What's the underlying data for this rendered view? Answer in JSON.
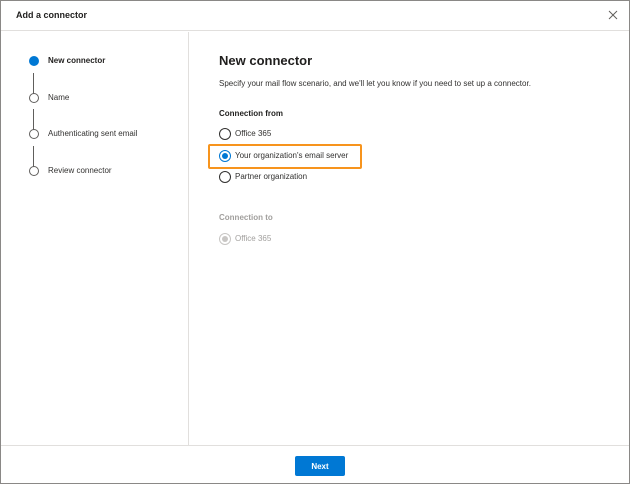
{
  "dialog": {
    "title": "Add a connector",
    "close_icon": "close-icon"
  },
  "steps": [
    {
      "label": "New connector",
      "active": true
    },
    {
      "label": "Name",
      "active": false
    },
    {
      "label": "Authenticating sent email",
      "active": false
    },
    {
      "label": "Review connector",
      "active": false
    }
  ],
  "main": {
    "title": "New connector",
    "description": "Specify your mail flow scenario, and we'll let you know if you need to set up a connector.",
    "connection_from": {
      "label": "Connection from",
      "options": [
        {
          "label": "Office 365",
          "checked": false
        },
        {
          "label": "Your organization's email server",
          "checked": true
        },
        {
          "label": "Partner organization",
          "checked": false
        }
      ]
    },
    "connection_to": {
      "label": "Connection to",
      "options": [
        {
          "label": "Office 365",
          "checked": true,
          "disabled": true
        }
      ]
    }
  },
  "footer": {
    "next_label": "Next"
  },
  "colors": {
    "accent": "#0078d4",
    "highlight": "#f7941d",
    "disabled": "#a19f9d"
  }
}
